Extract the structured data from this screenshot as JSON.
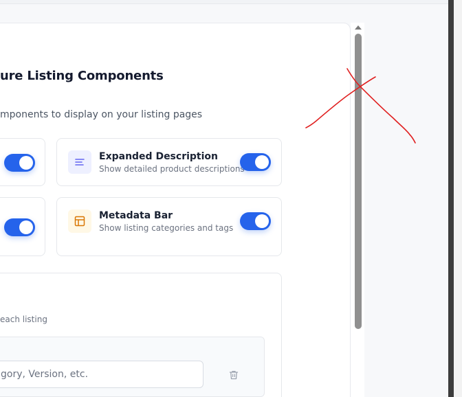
{
  "page": {
    "title": "ure Listing Components",
    "subtitle": "mponents to display on your listing pages"
  },
  "components": [
    {
      "name": "Expanded Description",
      "description": "Show detailed product descriptions",
      "enabled": true,
      "icon": "lines-icon",
      "icon_color": "#6366f1",
      "icon_bg": "#eef0ff"
    },
    {
      "name": "Metadata Bar",
      "description": "Show listing categories and tags",
      "enabled": true,
      "icon": "layout-icon",
      "icon_color": "#d97706",
      "icon_bg": "#fff8e6"
    }
  ],
  "partial_cards": [
    {
      "enabled": true
    },
    {
      "enabled": true
    }
  ],
  "fields_section": {
    "helper": "each listing",
    "input_placeholder": "gory, Version, etc."
  },
  "colors": {
    "accent": "#2563eb",
    "annotation": "#e02020"
  }
}
